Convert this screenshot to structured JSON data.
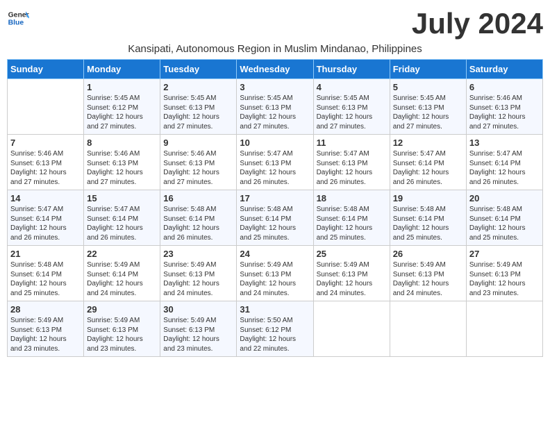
{
  "logo": {
    "line1": "General",
    "line2": "Blue"
  },
  "title": "July 2024",
  "subtitle": "Kansipati, Autonomous Region in Muslim Mindanao, Philippines",
  "days_header": [
    "Sunday",
    "Monday",
    "Tuesday",
    "Wednesday",
    "Thursday",
    "Friday",
    "Saturday"
  ],
  "weeks": [
    [
      {
        "day": "",
        "content": ""
      },
      {
        "day": "1",
        "content": "Sunrise: 5:45 AM\nSunset: 6:12 PM\nDaylight: 12 hours\nand 27 minutes."
      },
      {
        "day": "2",
        "content": "Sunrise: 5:45 AM\nSunset: 6:13 PM\nDaylight: 12 hours\nand 27 minutes."
      },
      {
        "day": "3",
        "content": "Sunrise: 5:45 AM\nSunset: 6:13 PM\nDaylight: 12 hours\nand 27 minutes."
      },
      {
        "day": "4",
        "content": "Sunrise: 5:45 AM\nSunset: 6:13 PM\nDaylight: 12 hours\nand 27 minutes."
      },
      {
        "day": "5",
        "content": "Sunrise: 5:45 AM\nSunset: 6:13 PM\nDaylight: 12 hours\nand 27 minutes."
      },
      {
        "day": "6",
        "content": "Sunrise: 5:46 AM\nSunset: 6:13 PM\nDaylight: 12 hours\nand 27 minutes."
      }
    ],
    [
      {
        "day": "7",
        "content": "Sunrise: 5:46 AM\nSunset: 6:13 PM\nDaylight: 12 hours\nand 27 minutes."
      },
      {
        "day": "8",
        "content": "Sunrise: 5:46 AM\nSunset: 6:13 PM\nDaylight: 12 hours\nand 27 minutes."
      },
      {
        "day": "9",
        "content": "Sunrise: 5:46 AM\nSunset: 6:13 PM\nDaylight: 12 hours\nand 27 minutes."
      },
      {
        "day": "10",
        "content": "Sunrise: 5:47 AM\nSunset: 6:13 PM\nDaylight: 12 hours\nand 26 minutes."
      },
      {
        "day": "11",
        "content": "Sunrise: 5:47 AM\nSunset: 6:13 PM\nDaylight: 12 hours\nand 26 minutes."
      },
      {
        "day": "12",
        "content": "Sunrise: 5:47 AM\nSunset: 6:14 PM\nDaylight: 12 hours\nand 26 minutes."
      },
      {
        "day": "13",
        "content": "Sunrise: 5:47 AM\nSunset: 6:14 PM\nDaylight: 12 hours\nand 26 minutes."
      }
    ],
    [
      {
        "day": "14",
        "content": "Sunrise: 5:47 AM\nSunset: 6:14 PM\nDaylight: 12 hours\nand 26 minutes."
      },
      {
        "day": "15",
        "content": "Sunrise: 5:47 AM\nSunset: 6:14 PM\nDaylight: 12 hours\nand 26 minutes."
      },
      {
        "day": "16",
        "content": "Sunrise: 5:48 AM\nSunset: 6:14 PM\nDaylight: 12 hours\nand 26 minutes."
      },
      {
        "day": "17",
        "content": "Sunrise: 5:48 AM\nSunset: 6:14 PM\nDaylight: 12 hours\nand 25 minutes."
      },
      {
        "day": "18",
        "content": "Sunrise: 5:48 AM\nSunset: 6:14 PM\nDaylight: 12 hours\nand 25 minutes."
      },
      {
        "day": "19",
        "content": "Sunrise: 5:48 AM\nSunset: 6:14 PM\nDaylight: 12 hours\nand 25 minutes."
      },
      {
        "day": "20",
        "content": "Sunrise: 5:48 AM\nSunset: 6:14 PM\nDaylight: 12 hours\nand 25 minutes."
      }
    ],
    [
      {
        "day": "21",
        "content": "Sunrise: 5:48 AM\nSunset: 6:14 PM\nDaylight: 12 hours\nand 25 minutes."
      },
      {
        "day": "22",
        "content": "Sunrise: 5:49 AM\nSunset: 6:14 PM\nDaylight: 12 hours\nand 24 minutes."
      },
      {
        "day": "23",
        "content": "Sunrise: 5:49 AM\nSunset: 6:13 PM\nDaylight: 12 hours\nand 24 minutes."
      },
      {
        "day": "24",
        "content": "Sunrise: 5:49 AM\nSunset: 6:13 PM\nDaylight: 12 hours\nand 24 minutes."
      },
      {
        "day": "25",
        "content": "Sunrise: 5:49 AM\nSunset: 6:13 PM\nDaylight: 12 hours\nand 24 minutes."
      },
      {
        "day": "26",
        "content": "Sunrise: 5:49 AM\nSunset: 6:13 PM\nDaylight: 12 hours\nand 24 minutes."
      },
      {
        "day": "27",
        "content": "Sunrise: 5:49 AM\nSunset: 6:13 PM\nDaylight: 12 hours\nand 23 minutes."
      }
    ],
    [
      {
        "day": "28",
        "content": "Sunrise: 5:49 AM\nSunset: 6:13 PM\nDaylight: 12 hours\nand 23 minutes."
      },
      {
        "day": "29",
        "content": "Sunrise: 5:49 AM\nSunset: 6:13 PM\nDaylight: 12 hours\nand 23 minutes."
      },
      {
        "day": "30",
        "content": "Sunrise: 5:49 AM\nSunset: 6:13 PM\nDaylight: 12 hours\nand 23 minutes."
      },
      {
        "day": "31",
        "content": "Sunrise: 5:50 AM\nSunset: 6:12 PM\nDaylight: 12 hours\nand 22 minutes."
      },
      {
        "day": "",
        "content": ""
      },
      {
        "day": "",
        "content": ""
      },
      {
        "day": "",
        "content": ""
      }
    ]
  ]
}
